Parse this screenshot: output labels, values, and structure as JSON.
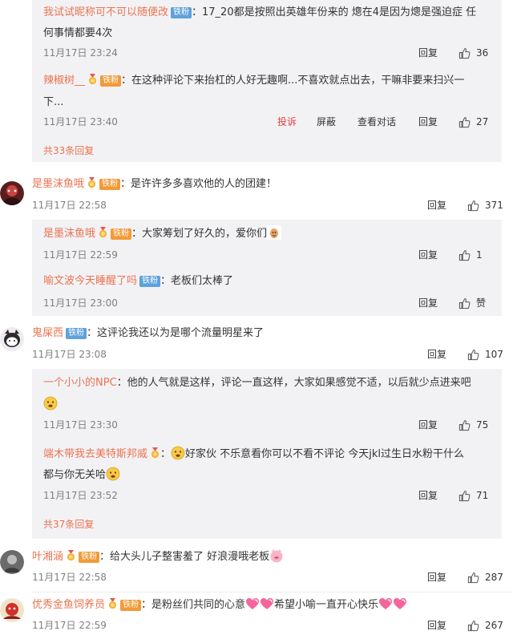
{
  "badges": {
    "fan": "铁粉"
  },
  "colors": {
    "username": "#eb7350",
    "background": "#ffffff",
    "reply_box": "#f2f2f5",
    "report": "#e33e3e"
  },
  "icons": {
    "like": "thumbs-up-icon",
    "medal": "medal-icon"
  },
  "actions": {
    "reply": "回复",
    "report": "投诉",
    "block": "屏蔽",
    "view_thread": "查看对话"
  },
  "thread0": {
    "reply_a": {
      "user": "我试试昵称可不可以随便改",
      "text1": "：17_20都是按照出英雄年份来的 熜在4是因为熜是强迫症 任",
      "text2": "何事情都要4次",
      "time": "11月17日 23:24",
      "likes": "36"
    },
    "reply_b": {
      "user": "辣椒树__",
      "text1": "：在这种评论下来抬杠的人好无趣啊...不喜欢就点出去，干嘛非要来扫兴一",
      "text2": "下...",
      "time": "11月17日 23:40",
      "likes": "27"
    },
    "more": "共33条回复"
  },
  "comment1": {
    "user": "是墨沫鱼哦",
    "text": "：是许许多多喜欢他的人的团建！",
    "time": "11月17日 22:58",
    "likes": "371",
    "reply_a": {
      "user": "是墨沫鱼哦",
      "text": "：大家筹划了好久的，爱你们",
      "time": "11月17日 22:59",
      "likes": "1"
    },
    "reply_b": {
      "user": "喻文波今天睡醒了吗",
      "text": "：老板们太棒了",
      "time": "11月17日 23:00",
      "likes": "赞"
    }
  },
  "comment2": {
    "user": "鬼屎西",
    "text": "：这评论我还以为是哪个流量明星来了",
    "time": "11月17日 23:08",
    "likes": "107",
    "reply_a": {
      "user": "一个小小的NPC",
      "text": "：他的人气就是这样，评论一直这样，大家如果感觉不适，以后就少点进来吧",
      "time": "11月17日 23:30",
      "likes": "75"
    },
    "reply_b": {
      "user": "端木带我去美特斯邦威",
      "text1": "好家伙 不乐意看你可以不看不评论 今天jkl过生日水粉干什么",
      "text2": "都与你无关哈",
      "time": "11月17日 23:52",
      "likes": "71"
    },
    "more": "共37条回复"
  },
  "comment3": {
    "user": "叶湘涵",
    "text": "：给大头儿子整害羞了 好浪漫哦老板",
    "time": "11月17日 22:58",
    "likes": "287"
  },
  "comment4": {
    "user": "优秀金鱼饲养员",
    "text1": "：是粉丝们共同的心意",
    "text2": "希望小喻一直开心快乐",
    "time": "11月17日 22:59",
    "likes": "267"
  }
}
